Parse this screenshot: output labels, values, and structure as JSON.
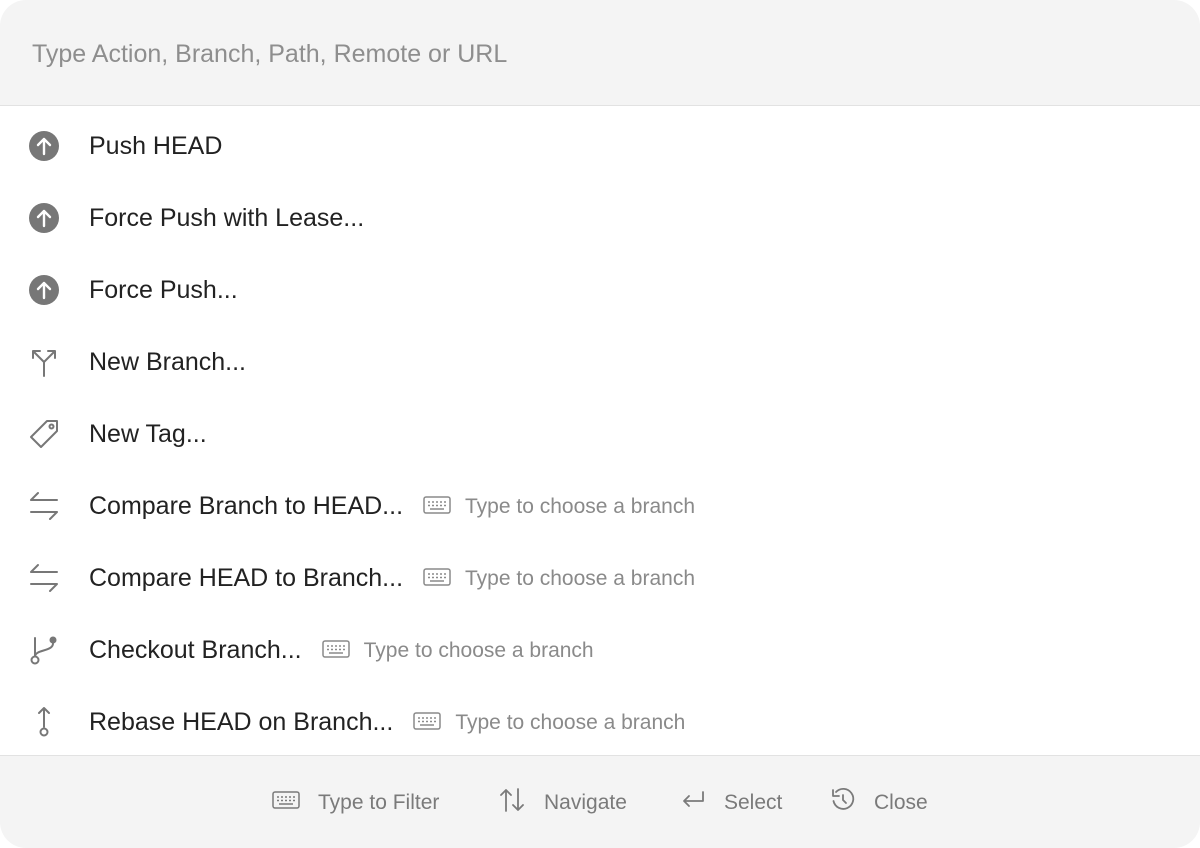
{
  "search": {
    "placeholder": "Type Action, Branch, Path, Remote or URL"
  },
  "actions": [
    {
      "icon": "arrow-up-circle-icon",
      "label": "Push HEAD",
      "hint": ""
    },
    {
      "icon": "arrow-up-circle-icon",
      "label": "Force Push with Lease...",
      "hint": ""
    },
    {
      "icon": "arrow-up-circle-icon",
      "label": "Force Push...",
      "hint": ""
    },
    {
      "icon": "branch-fork-icon",
      "label": "New Branch...",
      "hint": ""
    },
    {
      "icon": "tag-icon",
      "label": "New Tag...",
      "hint": ""
    },
    {
      "icon": "compare-arrows-icon",
      "label": "Compare Branch to HEAD...",
      "hint": "Type to choose a branch"
    },
    {
      "icon": "compare-arrows-icon",
      "label": "Compare HEAD to Branch...",
      "hint": "Type to choose a branch"
    },
    {
      "icon": "git-branch-icon",
      "label": "Checkout Branch...",
      "hint": "Type to choose a branch"
    },
    {
      "icon": "rebase-icon",
      "label": "Rebase HEAD on Branch...",
      "hint": "Type to choose a branch"
    }
  ],
  "footer": {
    "filter": "Type to Filter",
    "navigate": "Navigate",
    "select": "Select",
    "close": "Close"
  },
  "colors": {
    "panel": "#f4f4f4",
    "icon": "#777777",
    "text": "#222222",
    "muted": "#8a8a8a"
  }
}
